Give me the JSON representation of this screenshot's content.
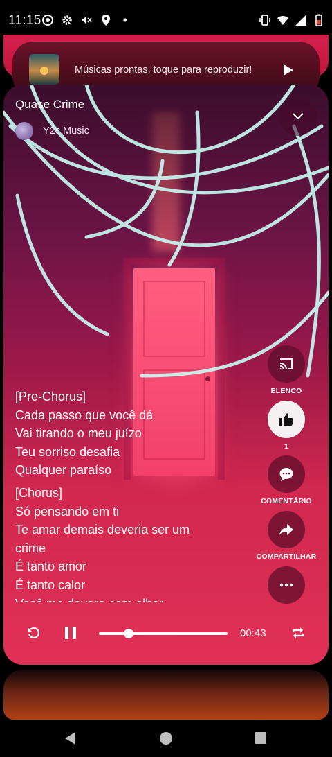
{
  "status_bar": {
    "time": "11:15",
    "left_icons": [
      "target-icon",
      "gear-icon",
      "volume-off-icon",
      "location-icon",
      "dot-icon"
    ],
    "right_icons": [
      "vibrate-icon",
      "wifi-icon",
      "signal-icon",
      "battery-icon"
    ]
  },
  "mini_player": {
    "text": "Músicas prontas, toque para reproduzir!",
    "play_icon": "play-icon"
  },
  "player": {
    "title": "Quase Crime",
    "artist": "Y2c Music",
    "collapse_icon": "chevron-down-icon",
    "lyrics_block1": [
      "[Pre-Chorus]",
      "Cada passo que você dá",
      "Vai tirando o meu juízo",
      "Teu sorriso desafia",
      "Qualquer paraíso"
    ],
    "lyrics_block2": [
      "[Chorus]",
      "Só pensando em ti",
      "Te amar demais deveria ser um",
      "crime",
      "É tanto amor",
      "É tanto calor",
      "Você me devora com olhar"
    ],
    "actions": {
      "cast_label": "ELENCO",
      "like_count": "1",
      "comment_label": "COMENTÁRIO",
      "share_label": "COMPARTILHAR",
      "more_icon": "more-horizontal-icon"
    },
    "controls": {
      "time": "00:43",
      "progress": 0.23
    }
  },
  "colors": {
    "accent": "#e13055",
    "button_bg": "#5c0c2a",
    "like_button": "#f5f0f1"
  }
}
